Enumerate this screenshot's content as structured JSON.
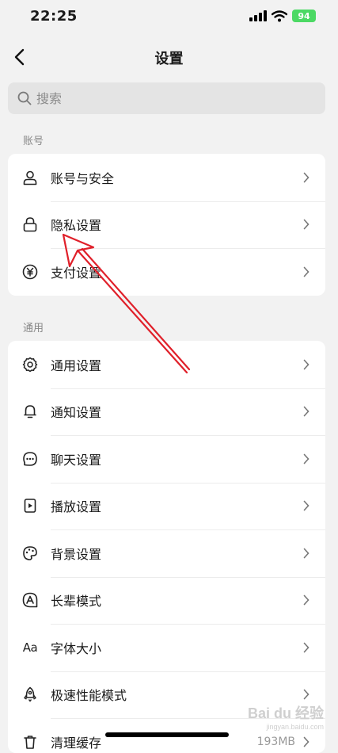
{
  "status_bar": {
    "time": "22:25",
    "battery": "94"
  },
  "nav": {
    "title": "设置"
  },
  "search": {
    "placeholder": "搜索"
  },
  "sections": [
    {
      "label": "账号",
      "items": [
        {
          "label": "账号与安全",
          "icon": "user-icon"
        },
        {
          "label": "隐私设置",
          "icon": "lock-icon"
        },
        {
          "label": "支付设置",
          "icon": "yen-icon"
        }
      ]
    },
    {
      "label": "通用",
      "items": [
        {
          "label": "通用设置",
          "icon": "gear-icon"
        },
        {
          "label": "通知设置",
          "icon": "bell-icon"
        },
        {
          "label": "聊天设置",
          "icon": "chat-icon"
        },
        {
          "label": "播放设置",
          "icon": "play-icon"
        },
        {
          "label": "背景设置",
          "icon": "palette-icon"
        },
        {
          "label": "长辈模式",
          "icon": "elder-mode-icon"
        },
        {
          "label": "字体大小",
          "icon": "font-size-icon",
          "icon_text": "Aa"
        },
        {
          "label": "极速性能模式",
          "icon": "rocket-icon"
        },
        {
          "label": "清理缓存",
          "icon": "trash-icon",
          "value": "193MB"
        }
      ]
    }
  ],
  "watermark": {
    "main": "Bai du 经验",
    "url": "jingyan.baidu.com"
  },
  "colors": {
    "background": "#f2f2f2",
    "card": "#ffffff",
    "battery": "#4cd964",
    "annotation": "#e0202a"
  }
}
